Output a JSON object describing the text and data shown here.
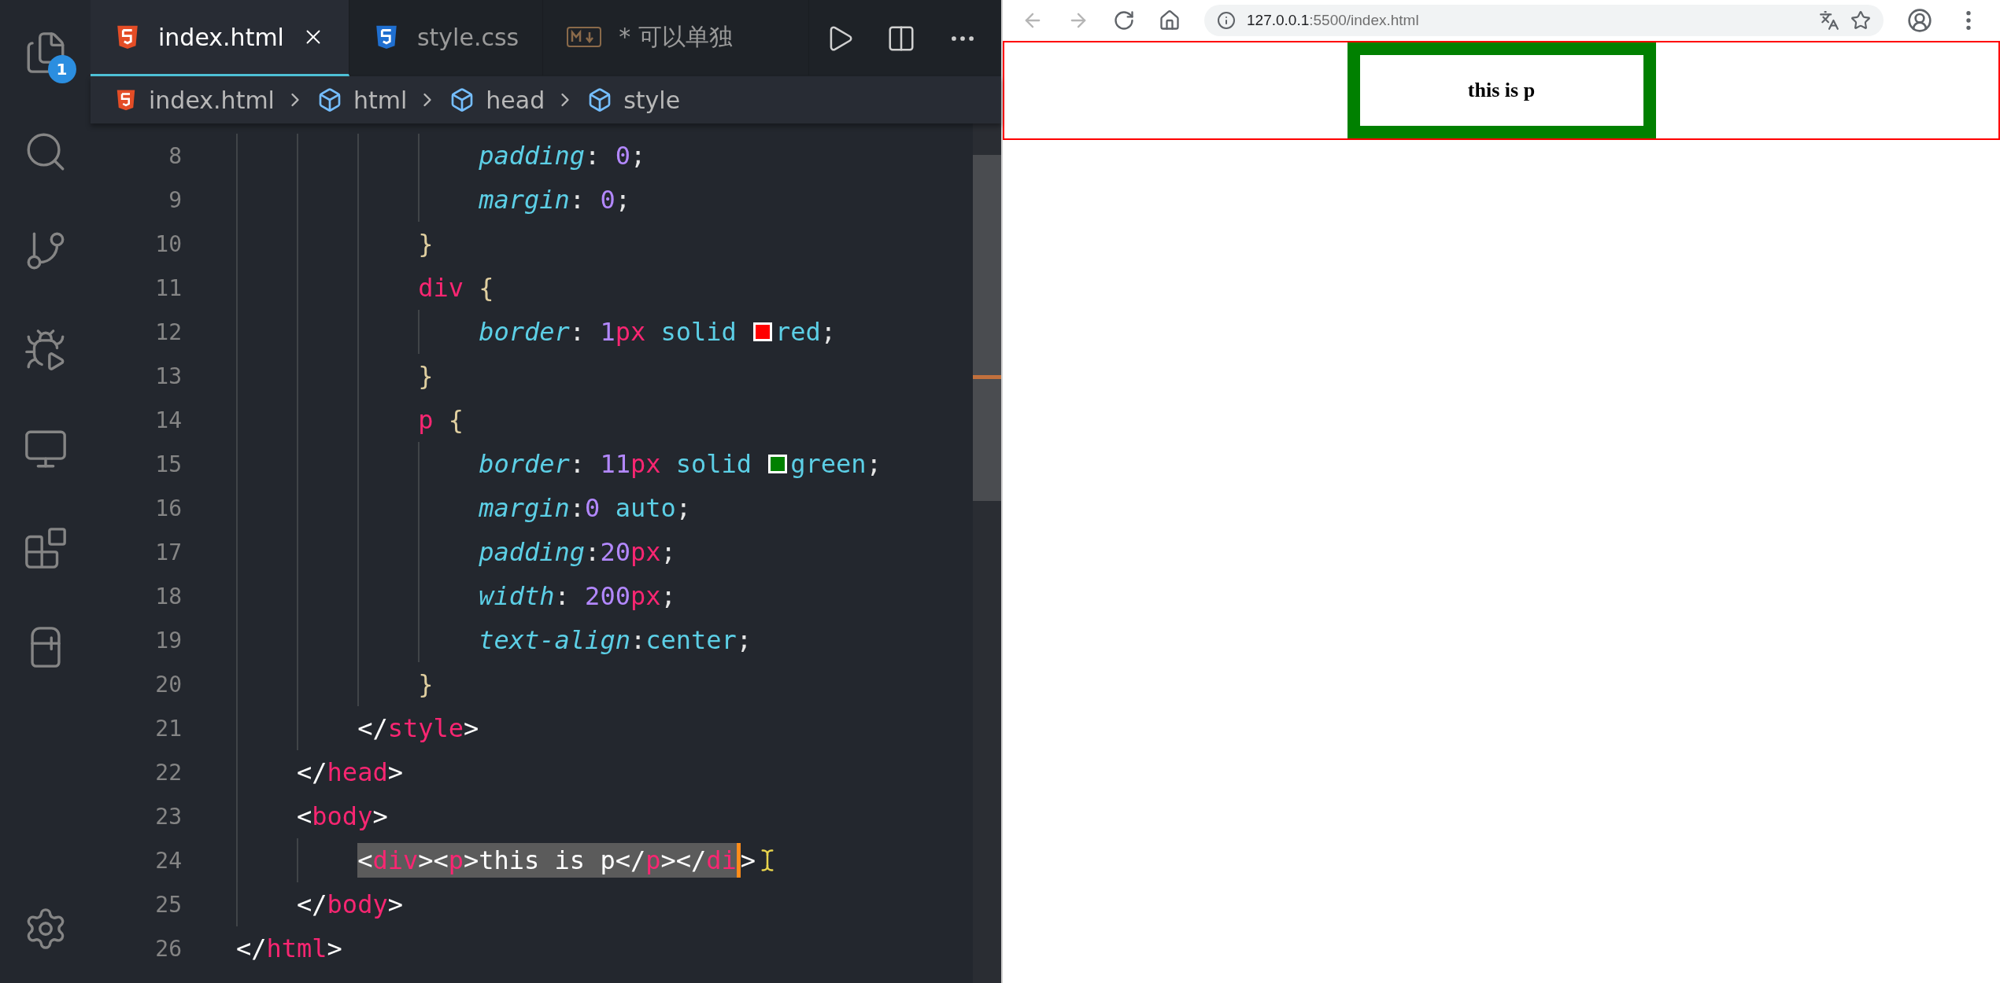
{
  "activity_bar": {
    "items": [
      {
        "kind": "explorer",
        "badge": "1"
      },
      {
        "kind": "search"
      },
      {
        "kind": "source-control"
      },
      {
        "kind": "run-debug"
      },
      {
        "kind": "remote"
      },
      {
        "kind": "extensions"
      },
      {
        "kind": "panel"
      }
    ],
    "bottom": [
      {
        "kind": "settings"
      }
    ]
  },
  "tabs": [
    {
      "label": "index.html",
      "kind": "html",
      "selected": true,
      "closable": true
    },
    {
      "label": "style.css",
      "kind": "css",
      "selected": false
    },
    {
      "label": "* 可以单独",
      "kind": "markdown",
      "selected": false
    }
  ],
  "editor_actions": [
    {
      "kind": "run"
    },
    {
      "kind": "split"
    },
    {
      "kind": "more"
    }
  ],
  "breadcrumb": [
    {
      "label": "index.html",
      "kind": "html"
    },
    {
      "label": "html",
      "kind": "symbol"
    },
    {
      "label": "head",
      "kind": "symbol"
    },
    {
      "label": "style",
      "kind": "symbol"
    }
  ],
  "code_lines": [
    {
      "number": "8",
      "tokens": [
        {
          "text": "                padding",
          "kind": "prop"
        },
        {
          "text": ": ",
          "kind": "punct"
        },
        {
          "text": "0",
          "kind": "num"
        },
        {
          "text": ";",
          "kind": "punct"
        }
      ]
    },
    {
      "number": "9",
      "tokens": [
        {
          "text": "                margin",
          "kind": "prop"
        },
        {
          "text": ": ",
          "kind": "punct"
        },
        {
          "text": "0",
          "kind": "num"
        },
        {
          "text": ";",
          "kind": "punct"
        }
      ]
    },
    {
      "number": "10",
      "tokens": [
        {
          "text": "            }",
          "kind": "brace"
        }
      ]
    },
    {
      "number": "11",
      "tokens": [
        {
          "text": "            div",
          "kind": "tag"
        },
        {
          "text": " {",
          "kind": "brace"
        }
      ]
    },
    {
      "number": "12",
      "tokens": [
        {
          "text": "                border",
          "kind": "prop"
        },
        {
          "text": ": ",
          "kind": "punct"
        },
        {
          "text": "1",
          "kind": "num"
        },
        {
          "text": "px",
          "kind": "unit"
        },
        {
          "text": " solid ",
          "kind": "value"
        },
        {
          "kind": "swatch",
          "color": "#ff0000"
        },
        {
          "text": "red",
          "kind": "value"
        },
        {
          "text": ";",
          "kind": "punct"
        }
      ]
    },
    {
      "number": "13",
      "tokens": [
        {
          "text": "            }",
          "kind": "brace"
        }
      ]
    },
    {
      "number": "14",
      "tokens": [
        {
          "text": "            p",
          "kind": "tag"
        },
        {
          "text": " {",
          "kind": "brace"
        }
      ]
    },
    {
      "number": "15",
      "tokens": [
        {
          "text": "                border",
          "kind": "prop"
        },
        {
          "text": ": ",
          "kind": "punct"
        },
        {
          "text": "11",
          "kind": "num"
        },
        {
          "text": "px",
          "kind": "unit"
        },
        {
          "text": " solid ",
          "kind": "value"
        },
        {
          "kind": "swatch",
          "color": "#008000"
        },
        {
          "text": "green",
          "kind": "value"
        },
        {
          "text": ";",
          "kind": "punct"
        }
      ]
    },
    {
      "number": "16",
      "tokens": [
        {
          "text": "                margin",
          "kind": "prop"
        },
        {
          "text": ":",
          "kind": "punct"
        },
        {
          "text": "0",
          "kind": "num"
        },
        {
          "text": " auto",
          "kind": "value"
        },
        {
          "text": ";",
          "kind": "punct"
        }
      ]
    },
    {
      "number": "17",
      "tokens": [
        {
          "text": "                padding",
          "kind": "prop"
        },
        {
          "text": ":",
          "kind": "punct"
        },
        {
          "text": "20",
          "kind": "num"
        },
        {
          "text": "px",
          "kind": "unit"
        },
        {
          "text": ";",
          "kind": "punct"
        }
      ]
    },
    {
      "number": "18",
      "tokens": [
        {
          "text": "                width",
          "kind": "prop"
        },
        {
          "text": ": ",
          "kind": "punct"
        },
        {
          "text": "200",
          "kind": "num"
        },
        {
          "text": "px",
          "kind": "unit"
        },
        {
          "text": ";",
          "kind": "punct"
        }
      ]
    },
    {
      "number": "19",
      "tokens": [
        {
          "text": "                text-align",
          "kind": "prop"
        },
        {
          "text": ":",
          "kind": "punct"
        },
        {
          "text": "center",
          "kind": "value"
        },
        {
          "text": ";",
          "kind": "punct"
        }
      ]
    },
    {
      "number": "20",
      "tokens": [
        {
          "text": "            }",
          "kind": "brace"
        }
      ]
    },
    {
      "number": "21",
      "tokens": [
        {
          "text": "        </",
          "kind": "bracket"
        },
        {
          "text": "style",
          "kind": "tag"
        },
        {
          "text": ">",
          "kind": "bracket"
        }
      ]
    },
    {
      "number": "22",
      "tokens": [
        {
          "text": "    </",
          "kind": "bracket"
        },
        {
          "text": "head",
          "kind": "tag"
        },
        {
          "text": ">",
          "kind": "bracket"
        }
      ]
    },
    {
      "number": "23",
      "tokens": [
        {
          "text": "    <",
          "kind": "bracket"
        },
        {
          "text": "body",
          "kind": "tag"
        },
        {
          "text": ">",
          "kind": "bracket"
        }
      ]
    },
    {
      "number": "24",
      "cursor": true,
      "tokens": [
        {
          "text": "        <",
          "kind": "bracket",
          "selected": true
        },
        {
          "text": "div",
          "kind": "tag",
          "selected": true
        },
        {
          "text": "><",
          "kind": "bracket",
          "selected": true
        },
        {
          "text": "p",
          "kind": "tag",
          "selected": true
        },
        {
          "text": ">this is p</",
          "kind": "bracket",
          "selected": true
        },
        {
          "text": "p",
          "kind": "tag",
          "selected": true
        },
        {
          "text": "></",
          "kind": "bracket",
          "selected": true
        },
        {
          "text": "di",
          "kind": "tag",
          "selected": true
        },
        {
          "text": ">",
          "kind": "bracket",
          "selected": false
        }
      ]
    },
    {
      "number": "25",
      "tokens": [
        {
          "text": "    </",
          "kind": "bracket"
        },
        {
          "text": "body",
          "kind": "tag"
        },
        {
          "text": ">",
          "kind": "bracket"
        }
      ]
    },
    {
      "number": "26",
      "tokens": [
        {
          "text": "</",
          "kind": "bracket"
        },
        {
          "text": "html",
          "kind": "tag"
        },
        {
          "text": ">",
          "kind": "bracket"
        }
      ]
    }
  ],
  "browser": {
    "nav": [
      {
        "kind": "back",
        "disabled": true
      },
      {
        "kind": "forward",
        "disabled": true
      },
      {
        "kind": "reload",
        "disabled": false
      },
      {
        "kind": "home",
        "disabled": false
      }
    ],
    "address": {
      "host": "127.0.0.1",
      "path": ":5500/index.html"
    },
    "actions": [
      {
        "kind": "translate"
      },
      {
        "kind": "bookmark"
      },
      {
        "kind": "profile"
      },
      {
        "kind": "menu"
      }
    ],
    "page": {
      "paragraph": "this is p"
    }
  }
}
